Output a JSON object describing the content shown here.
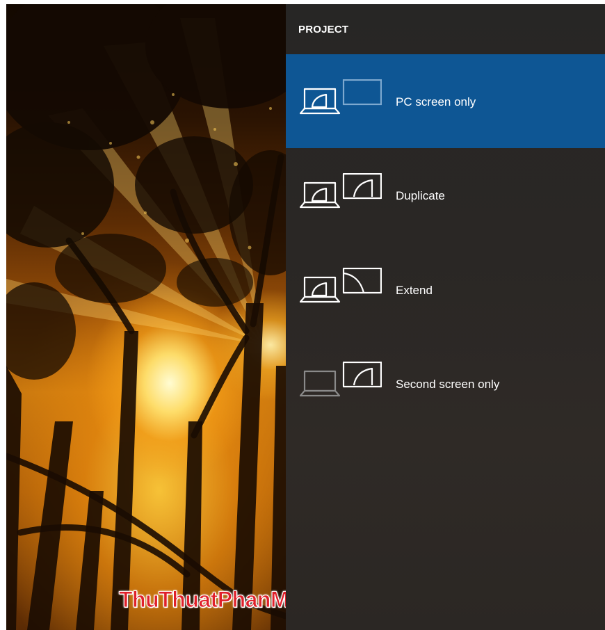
{
  "panel": {
    "title": "PROJECT",
    "options": [
      {
        "label": "PC screen only",
        "selected": true,
        "icon": "pc-screen-only-icon"
      },
      {
        "label": "Duplicate",
        "selected": false,
        "icon": "duplicate-icon"
      },
      {
        "label": "Extend",
        "selected": false,
        "icon": "extend-icon"
      },
      {
        "label": "Second screen only",
        "selected": false,
        "icon": "second-screen-only-icon"
      }
    ]
  },
  "watermark": {
    "text": "ThuThuatPhanMem.vn"
  },
  "colors": {
    "accent_selected": "#0e5694",
    "panel_background": "#2a2725",
    "icon_active": "#ffffff",
    "icon_inactive": "#8a8a8a",
    "watermark_red": "#e0202a"
  }
}
